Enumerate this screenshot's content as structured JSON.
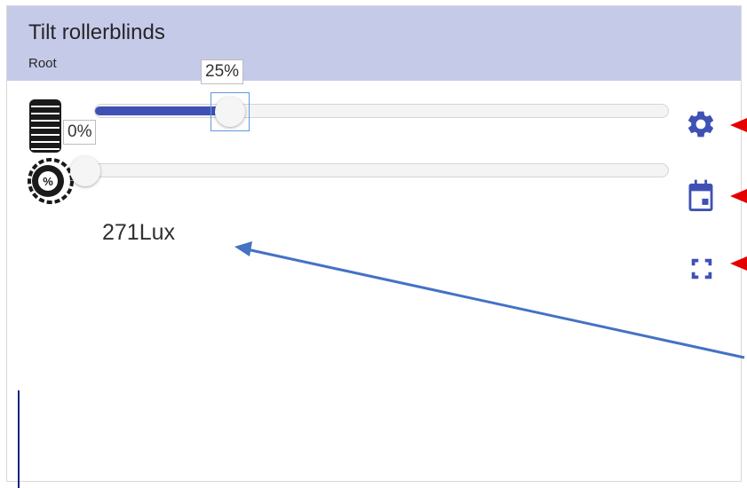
{
  "card": {
    "title": "Tilt rollerblinds",
    "subtitle": "Root"
  },
  "sliders": {
    "position": {
      "label": "25%",
      "value_percent": 25,
      "icon": "blinds-icon"
    },
    "tilt": {
      "label": "0%",
      "value_percent": 0,
      "icon": "tilt-percent-icon"
    }
  },
  "sensor": {
    "lux_text": "271Lux"
  },
  "side_icons": [
    "gear-icon",
    "calendar-icon",
    "fullscreen-icon"
  ],
  "colors": {
    "header_bg": "#c5cae9",
    "accent": "#3f51b5",
    "annotation_red": "#e50000",
    "annotation_blue": "#4472c4"
  }
}
